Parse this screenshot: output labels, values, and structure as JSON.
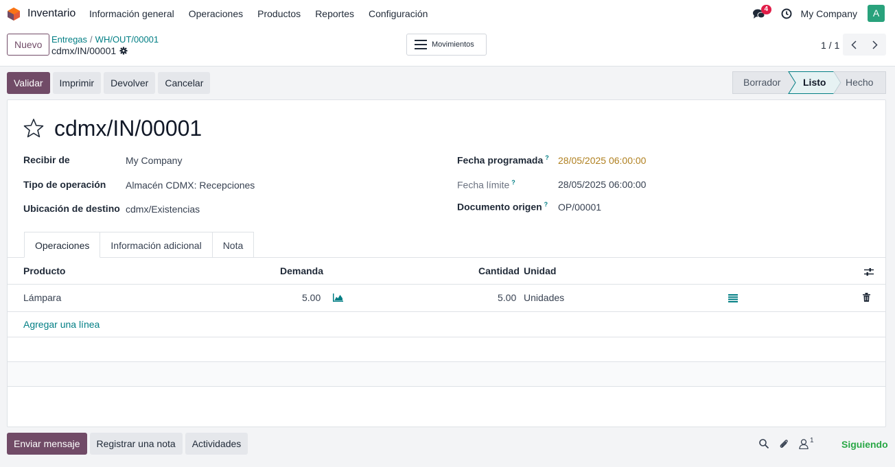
{
  "navbar": {
    "app_name": "Inventario",
    "menu": [
      "Información general",
      "Operaciones",
      "Productos",
      "Reportes",
      "Configuración"
    ],
    "messages_count": "4",
    "company": "My Company",
    "avatar_letter": "A"
  },
  "control": {
    "new_label": "Nuevo",
    "breadcrumb": [
      "Entregas",
      "WH/OUT/00001"
    ],
    "breadcrumb_sep": "/",
    "record": "cdmx/IN/00001",
    "moves_label": "Movimientos",
    "pager": "1 / 1"
  },
  "actions": [
    "Validar",
    "Imprimir",
    "Devolver",
    "Cancelar"
  ],
  "states": [
    "Borrador",
    "Listo",
    "Hecho"
  ],
  "active_state": "Listo",
  "form": {
    "title": "cdmx/IN/00001",
    "left": [
      {
        "label": "Recibir de",
        "value": "My Company"
      },
      {
        "label": "Tipo de operación",
        "value": "Almacén CDMX: Recepciones"
      },
      {
        "label": "Ubicación de destino",
        "value": "cdmx/Existencias"
      }
    ],
    "right": [
      {
        "label": "Fecha programada",
        "help": "?",
        "value": "28/05/2025 06:00:00"
      },
      {
        "label": "Fecha límite",
        "help": "?",
        "value": "28/05/2025 06:00:00"
      },
      {
        "label": "Documento origen",
        "help": "?",
        "value": "OP/00001"
      }
    ]
  },
  "tabs": [
    "Operaciones",
    "Información adicional",
    "Nota"
  ],
  "table": {
    "headers": {
      "product": "Producto",
      "demand": "Demanda",
      "quantity": "Cantidad",
      "unit": "Unidad"
    },
    "rows": [
      {
        "product": "Lámpara",
        "demand": "5.00",
        "quantity": "5.00",
        "unit": "Unidades"
      }
    ],
    "add_line": "Agregar una línea"
  },
  "chatter": {
    "buttons": [
      "Enviar mensaje",
      "Registrar una nota",
      "Actividades"
    ],
    "followers_count": "1",
    "follow_label": "Siguiendo"
  },
  "colors": {
    "primary": "#714b67",
    "link": "#017e84",
    "success": "#28a745",
    "warning": "#b08020",
    "badge": "#e11d48"
  }
}
